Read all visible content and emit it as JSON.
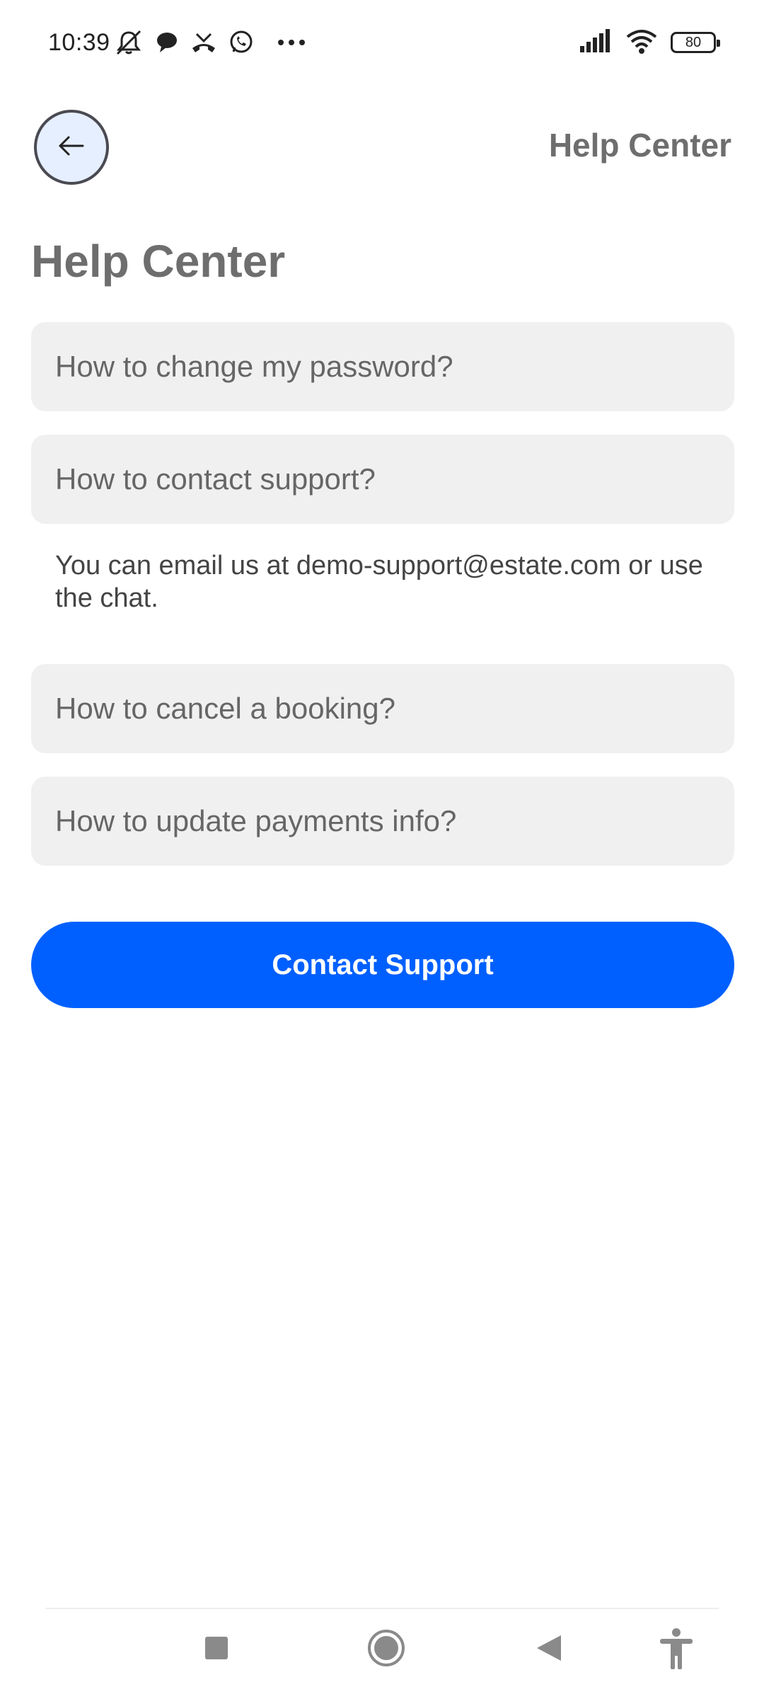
{
  "status_bar": {
    "time": "10:39",
    "battery": "80",
    "left_icons": [
      "mute-icon",
      "chat-icon",
      "missed-call-icon",
      "whatsapp-icon",
      "more-icon"
    ],
    "right_icons": [
      "signal-icon",
      "wifi-icon",
      "battery-icon"
    ]
  },
  "header": {
    "back_icon": "arrow-left-icon",
    "title": "Help Center"
  },
  "page": {
    "title": "Help Center"
  },
  "faq": {
    "items": [
      {
        "question": "How to change my password?"
      },
      {
        "question": "How to contact support?",
        "answer": "You can email us at demo-support@estate.com or use the chat."
      },
      {
        "question": "How to cancel a booking?"
      },
      {
        "question": "How to update payments info?"
      }
    ]
  },
  "actions": {
    "contact_label": "Contact Support"
  },
  "nav_bar": {
    "icons": [
      "recents-icon",
      "home-icon",
      "back-icon",
      "accessibility-icon"
    ]
  },
  "colors": {
    "accent": "#0060ff",
    "card_bg": "#f0f0f0",
    "back_button_bg": "#e6efff"
  }
}
